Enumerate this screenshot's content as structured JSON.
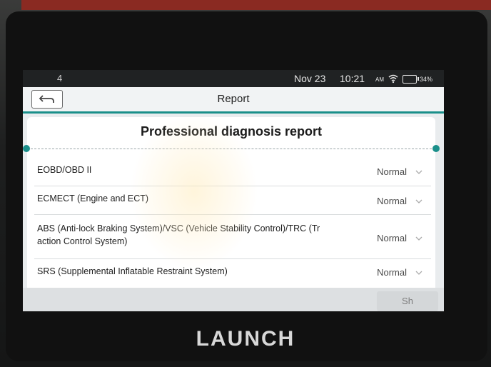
{
  "status_bar": {
    "left_text": "4",
    "date": "Nov 23",
    "time": "10:21",
    "ampm": "AM",
    "battery_pct": "34%"
  },
  "titlebar": {
    "title": "Report",
    "back_icon": "back-arrow-icon"
  },
  "report": {
    "heading": "Professional diagnosis report",
    "rows": [
      {
        "label": "EOBD/OBD II",
        "status": "Normal"
      },
      {
        "label": "ECMECT (Engine and ECT)",
        "status": "Normal"
      },
      {
        "label": "ABS (Anti-lock Braking System)/VSC (Vehicle Stability Control)/TRC (Tr",
        "label2": "action Control System)",
        "status": "Normal"
      },
      {
        "label": "SRS (Supplemental Inflatable Restraint System)",
        "status": "Normal"
      }
    ]
  },
  "share_label": "Sh",
  "device_logo": "LAUNCH",
  "colors": {
    "accent": "#1a8f8a",
    "bezel": "#111111"
  }
}
